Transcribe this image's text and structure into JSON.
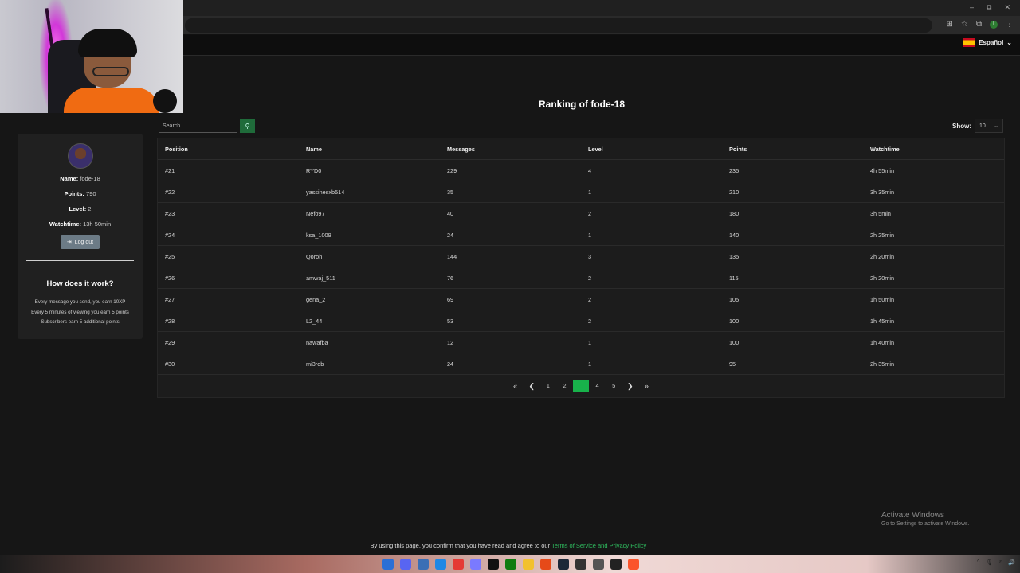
{
  "browser": {
    "controls": [
      "–",
      "⧉",
      "✕"
    ],
    "icons": [
      "translate-icon",
      "star-icon",
      "extensions-icon",
      "profile-icon",
      "menu-icon"
    ]
  },
  "header": {
    "language": "Español",
    "flag_colors": [
      "#c60b1e",
      "#ffc400"
    ]
  },
  "sidebar": {
    "name_label": "Name:",
    "name_value": "fode-18",
    "points_label": "Points:",
    "points_value": "790",
    "level_label": "Level:",
    "level_value": "2",
    "watchtime_label": "Watchtime:",
    "watchtime_value": "13h 50min",
    "logout_label": "Log out",
    "how_title": "How does it work?",
    "how_lines": [
      "Every message you send, you earn 10XP",
      "Every 5 minutes of viewing you earn 5 points",
      "Subscribers earn 5 additional points"
    ]
  },
  "main": {
    "title": "Ranking of fode-18",
    "search_placeholder": "Search...",
    "show_label": "Show:",
    "show_value": "10",
    "columns": [
      "Position",
      "Name",
      "Messages",
      "Level",
      "Points",
      "Watchtime"
    ],
    "rows": [
      [
        "#21",
        "RYD0",
        "229",
        "4",
        "235",
        "4h 55min"
      ],
      [
        "#22",
        "yassinesxb514",
        "35",
        "1",
        "210",
        "3h 35min"
      ],
      [
        "#23",
        "Nefo97",
        "40",
        "2",
        "180",
        "3h 5min"
      ],
      [
        "#24",
        "ksa_1009",
        "24",
        "1",
        "140",
        "2h 25min"
      ],
      [
        "#25",
        "Qoroh",
        "144",
        "3",
        "135",
        "2h 20min"
      ],
      [
        "#26",
        "amwaj_511",
        "76",
        "2",
        "115",
        "2h 20min"
      ],
      [
        "#27",
        "gena_2",
        "69",
        "2",
        "105",
        "1h 50min"
      ],
      [
        "#28",
        "L2_44",
        "53",
        "2",
        "100",
        "1h 45min"
      ],
      [
        "#29",
        "nawafba",
        "12",
        "1",
        "100",
        "1h 40min"
      ],
      [
        "#30",
        "mi3rob",
        "24",
        "1",
        "95",
        "2h 35min"
      ]
    ],
    "pagination": {
      "first": "«",
      "prev": "❮",
      "pages": [
        "1",
        "2",
        "3",
        "4",
        "5"
      ],
      "active": "3",
      "next": "❯",
      "last": "»"
    },
    "accent_color": "#18b24b"
  },
  "watermark": {
    "line1": "Activate Windows",
    "line2": "Go to Settings to activate Windows."
  },
  "footer": {
    "prefix": "By using this page, you confirm that you have read and agree to our",
    "link": "Terms of Service and Privacy Policy",
    "suffix": "."
  },
  "taskbar": {
    "apps": [
      "start-icon",
      "discord-icon",
      "calendar-icon",
      "edge-icon",
      "chrome-icon",
      "app-icon",
      "tiktok-icon",
      "xbox-icon",
      "files-icon",
      "app-icon",
      "steam-icon",
      "app-icon",
      "app-icon",
      "obs-icon",
      "brave-icon"
    ],
    "tray": [
      "^",
      "🎙",
      "ε",
      "🔊"
    ]
  }
}
